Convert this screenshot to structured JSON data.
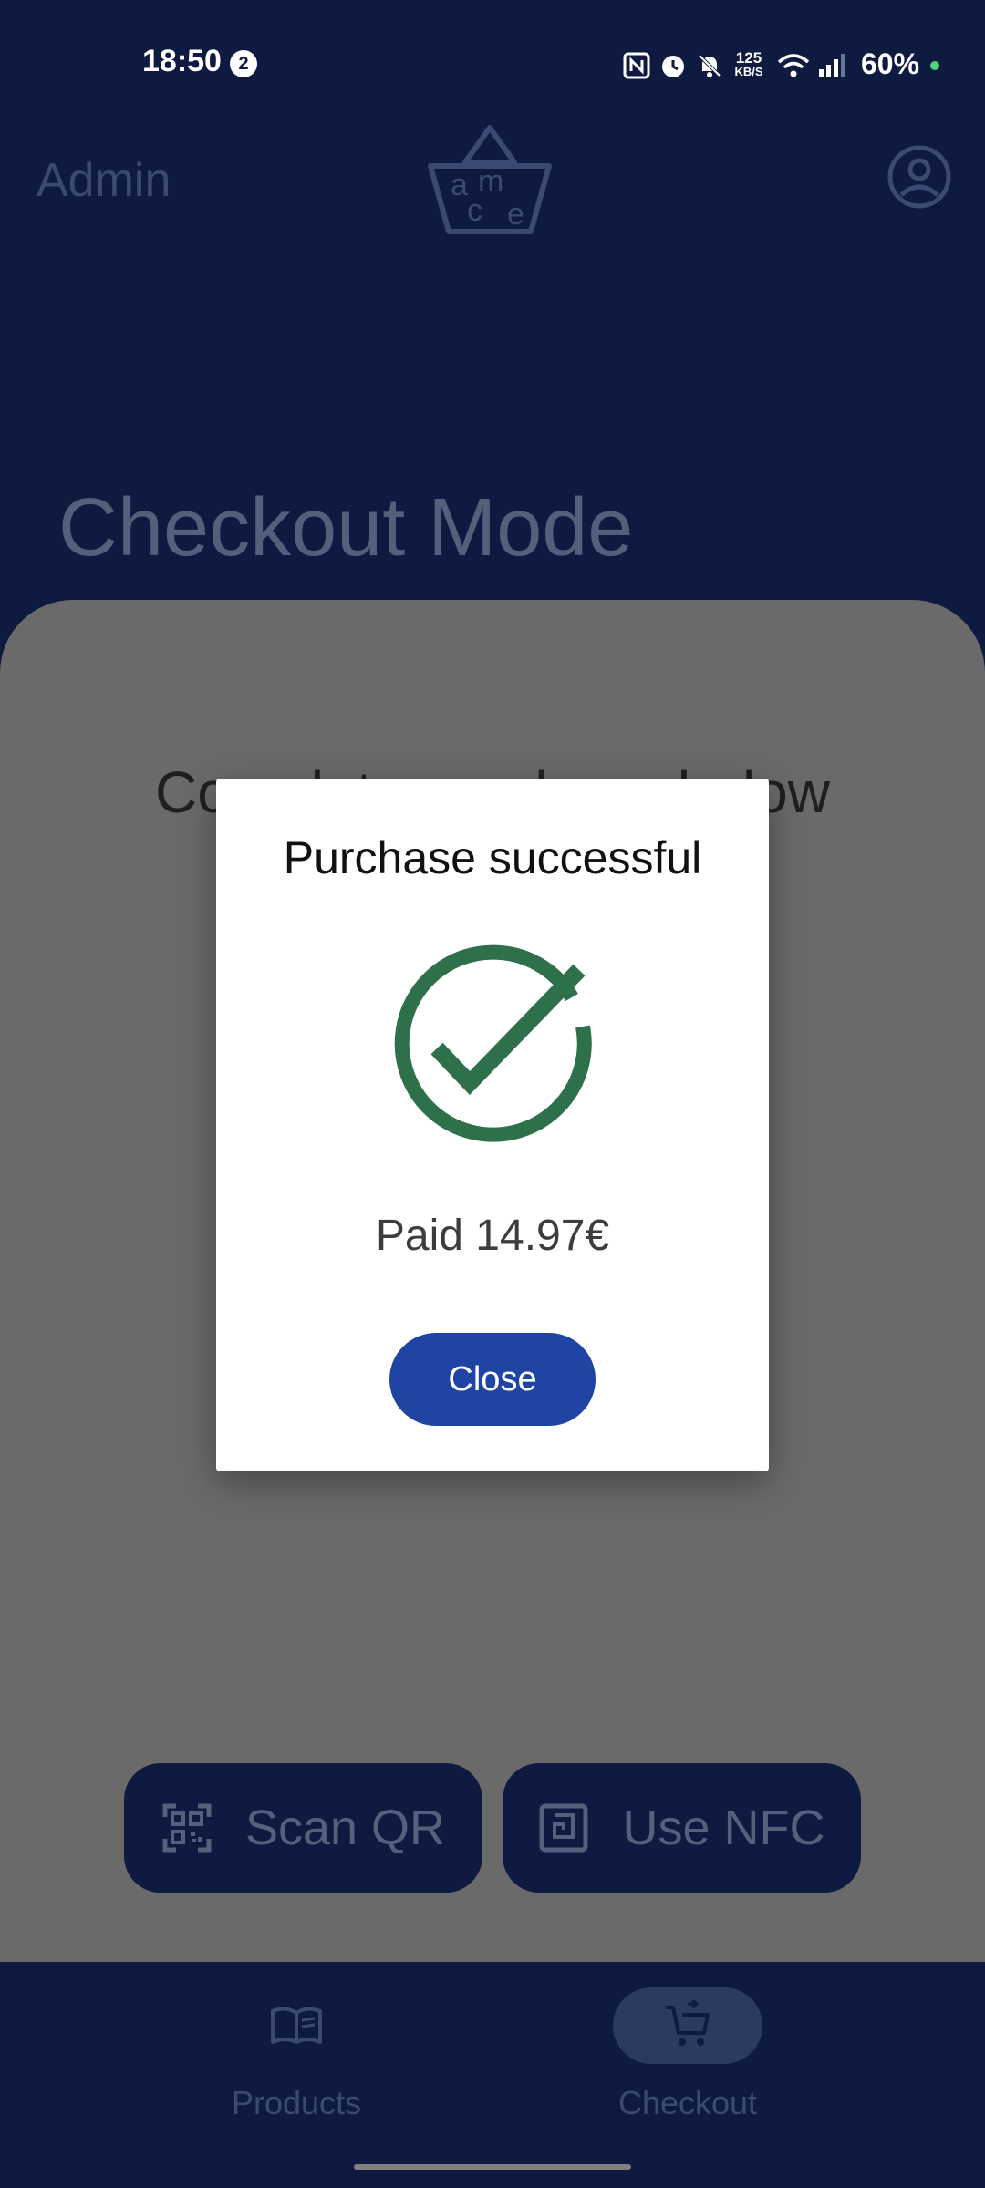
{
  "status_bar": {
    "time": "18:50",
    "notification_count": "2",
    "network_speed_value": "125",
    "network_speed_unit": "KB/S",
    "battery": "60%"
  },
  "header": {
    "user_label": "Admin",
    "logo_letters": [
      "a",
      "m",
      "c",
      "e"
    ],
    "account_icon": "account-circle-icon"
  },
  "page": {
    "title": "Checkout Mode",
    "instruction": "Complete purchase below"
  },
  "actions": {
    "scan_qr": "Scan QR",
    "use_nfc": "Use NFC"
  },
  "nav": {
    "items": [
      {
        "label": "Products",
        "icon": "book-icon",
        "active": false
      },
      {
        "label": "Checkout",
        "icon": "cart-icon",
        "active": true
      }
    ]
  },
  "modal": {
    "title": "Purchase successful",
    "message": "Paid 14.97€",
    "close_label": "Close",
    "icon": "check-circle-icon"
  },
  "colors": {
    "primary_dark": "#0e1a40",
    "button_blue": "#1f44a3",
    "success_green": "#2e7049",
    "scrim": "#6a6a6a"
  }
}
